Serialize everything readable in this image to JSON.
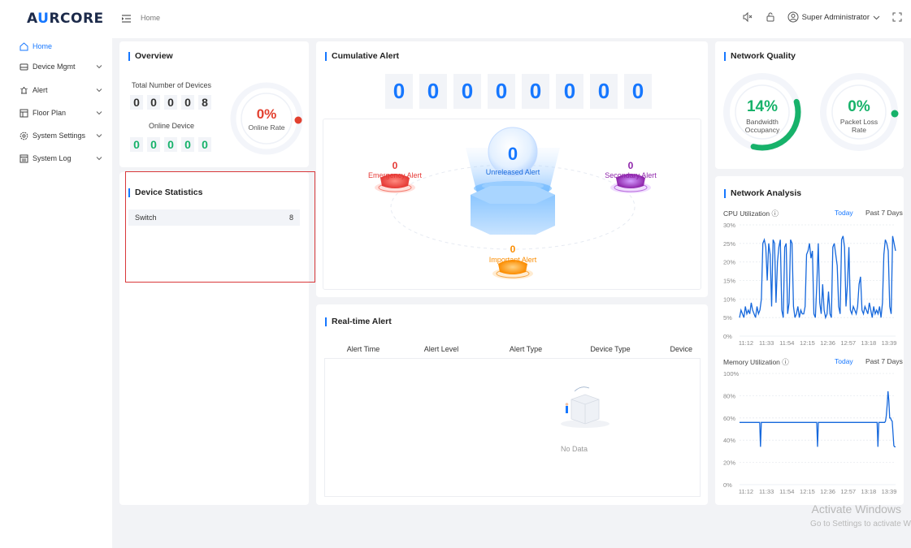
{
  "header": {
    "logo_prefix": "A",
    "logo_accent": "U",
    "logo_rest": "RCORE",
    "breadcrumb": "Home",
    "user_name": "Super Administrator"
  },
  "sidebar": {
    "items": [
      {
        "label": "Home",
        "icon": "home-icon"
      },
      {
        "label": "Device Mgmt",
        "icon": "device-icon"
      },
      {
        "label": "Alert",
        "icon": "alert-icon"
      },
      {
        "label": "Floor Plan",
        "icon": "floor-plan-icon"
      },
      {
        "label": "System Settings",
        "icon": "gear-icon"
      },
      {
        "label": "System Log",
        "icon": "log-icon"
      }
    ]
  },
  "overview": {
    "title": "Overview",
    "total_label": "Total Number of Devices",
    "total_digits": [
      "0",
      "0",
      "0",
      "0",
      "8"
    ],
    "online_label": "Online Device",
    "online_digits": [
      "0",
      "0",
      "0",
      "0",
      "0"
    ],
    "online_rate_value": "0%",
    "online_rate_label": "Online Rate",
    "online_rate_fraction": 0.0
  },
  "device_stats": {
    "title": "Device Statistics",
    "rows": [
      {
        "name": "Switch",
        "count": "8"
      }
    ]
  },
  "cumulative_alert": {
    "title": "Cumulative Alert",
    "digits": [
      "0",
      "0",
      "0",
      "0",
      "0",
      "0",
      "0",
      "0"
    ],
    "unreleased": {
      "value": "0",
      "label": "Unreleased Alert"
    },
    "emergency": {
      "value": "0",
      "label": "Emergency Alert"
    },
    "secondary": {
      "value": "0",
      "label": "Secondary Alert"
    },
    "important": {
      "value": "0",
      "label": "Important Alert"
    }
  },
  "realtime_alert": {
    "title": "Real-time Alert",
    "columns": [
      "Alert Time",
      "Alert Level",
      "Alert Type",
      "Device Type",
      "Device"
    ],
    "empty_text": "No Data"
  },
  "network_quality": {
    "title": "Network Quality",
    "bandwidth": {
      "value": "14%",
      "label_1": "Bandwidth",
      "label_2": "Occupancy",
      "fraction": 0.14
    },
    "packet_loss": {
      "value": "0%",
      "label_1": "Packet Loss",
      "label_2": "Rate",
      "fraction": 0.0
    }
  },
  "network_analysis": {
    "title": "Network Analysis",
    "tabs": [
      "Today",
      "Past 7 Days"
    ],
    "x_labels": [
      "11:12",
      "11:33",
      "11:54",
      "12:15",
      "12:36",
      "12:57",
      "13:18",
      "13:39"
    ]
  },
  "chart_data": [
    {
      "type": "line",
      "title": "CPU Utilization",
      "yticks": [
        "30%",
        "25%",
        "20%",
        "15%",
        "10%",
        "5%",
        "0%"
      ],
      "ylim": [
        0,
        30
      ],
      "grid": true,
      "color": "#1668dc",
      "values": [
        5,
        7,
        6,
        5,
        8,
        6,
        7,
        6,
        9,
        7,
        6,
        5,
        8,
        6,
        7,
        10,
        25,
        26,
        24,
        15,
        25,
        22,
        8,
        26,
        25,
        9,
        20,
        24,
        26,
        7,
        5,
        24,
        25,
        6,
        9,
        26,
        25,
        8,
        5,
        6,
        8,
        5,
        7,
        6,
        6,
        8,
        22,
        23,
        25,
        21,
        23,
        6,
        5,
        14,
        25,
        9,
        6,
        14,
        7,
        5,
        6,
        12,
        6,
        5,
        24,
        25,
        22,
        19,
        8,
        6,
        26,
        27,
        24,
        8,
        14,
        24,
        7,
        6,
        8,
        7,
        6,
        8,
        14,
        16,
        7,
        6,
        8,
        7,
        6,
        9,
        7,
        5,
        8,
        6,
        7,
        6,
        8,
        5,
        9,
        22,
        26,
        25,
        23,
        8,
        6,
        27,
        25,
        23
      ]
    },
    {
      "type": "line",
      "title": "Memory Utilization",
      "yticks": [
        "100%",
        "80%",
        "60%",
        "40%",
        "20%",
        "0%"
      ],
      "ylim": [
        0,
        100
      ],
      "grid": true,
      "color": "#1668dc",
      "values": [
        56,
        56,
        56,
        56,
        56,
        56,
        56,
        56,
        56,
        56,
        56,
        56,
        56,
        56,
        56,
        56,
        56,
        56,
        56,
        56,
        56,
        56,
        56,
        56,
        56,
        34,
        56,
        56,
        56,
        56,
        56,
        56,
        56,
        56,
        56,
        56,
        56,
        56,
        56,
        56,
        56,
        56,
        56,
        56,
        56,
        56,
        56,
        56,
        56,
        56,
        56,
        56,
        56,
        56,
        56,
        56,
        56,
        56,
        56,
        56,
        56,
        56,
        56,
        56,
        56,
        56,
        56,
        56,
        56,
        56,
        56,
        56,
        56,
        56,
        56,
        56,
        56,
        56,
        56,
        56,
        56,
        56,
        56,
        56,
        56,
        56,
        56,
        56,
        56,
        56,
        56,
        56,
        56,
        34,
        56,
        56,
        56,
        56,
        56,
        56,
        56,
        56,
        56,
        56,
        56,
        56,
        56,
        56,
        56,
        56,
        56,
        56,
        56,
        56,
        56,
        56,
        56,
        56,
        56,
        56,
        56,
        56,
        56,
        56,
        56,
        56,
        56,
        56,
        56,
        56,
        56,
        56,
        56,
        56,
        56,
        56,
        56,
        56,
        56,
        56,
        56,
        56,
        56,
        56,
        56,
        56,
        56,
        56,
        56,
        56,
        56,
        56,
        56,
        56,
        56,
        56,
        56,
        56,
        56,
        56,
        56,
        56,
        56,
        56,
        56,
        34,
        56,
        56,
        56,
        56,
        56,
        56,
        56,
        56,
        57,
        62,
        72,
        84,
        76,
        60,
        60,
        58,
        57,
        46,
        35,
        34,
        34
      ]
    }
  ],
  "watermark": {
    "line1": "Activate Windows",
    "line2": "Go to Settings to activate W"
  }
}
